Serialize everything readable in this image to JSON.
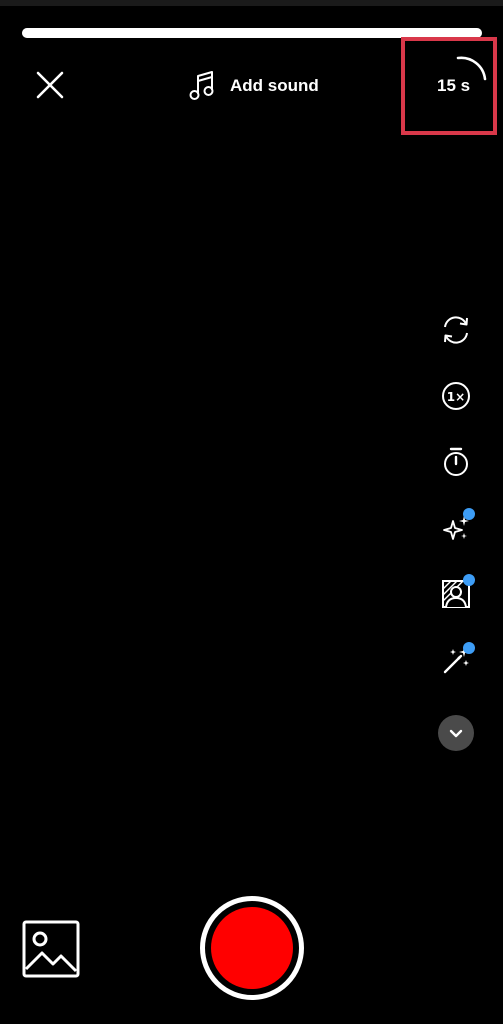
{
  "header": {
    "add_sound_label": "Add sound",
    "duration_label": "15 s"
  },
  "recording": {
    "progress_fraction": 1.0
  },
  "side_tools": [
    {
      "name": "flip-camera-icon",
      "has_badge": false
    },
    {
      "name": "speed-icon",
      "has_badge": false
    },
    {
      "name": "timer-icon",
      "has_badge": false
    },
    {
      "name": "effects-sparkle-icon",
      "has_badge": true
    },
    {
      "name": "green-screen-icon",
      "has_badge": true
    },
    {
      "name": "retouch-wand-icon",
      "has_badge": true
    },
    {
      "name": "chevron-down-icon",
      "has_badge": false
    }
  ],
  "colors": {
    "background": "#000000",
    "record": "#ff0000",
    "badge": "#3d9df6",
    "highlight": "#d9384a",
    "progress_track": "#5a5a5a",
    "progress_fill": "#ffffff"
  },
  "icons": {
    "close": "close-icon",
    "music": "music-note-icon",
    "duration_arc": "duration-arc-icon",
    "gallery": "gallery-icon",
    "record": "record-icon"
  }
}
